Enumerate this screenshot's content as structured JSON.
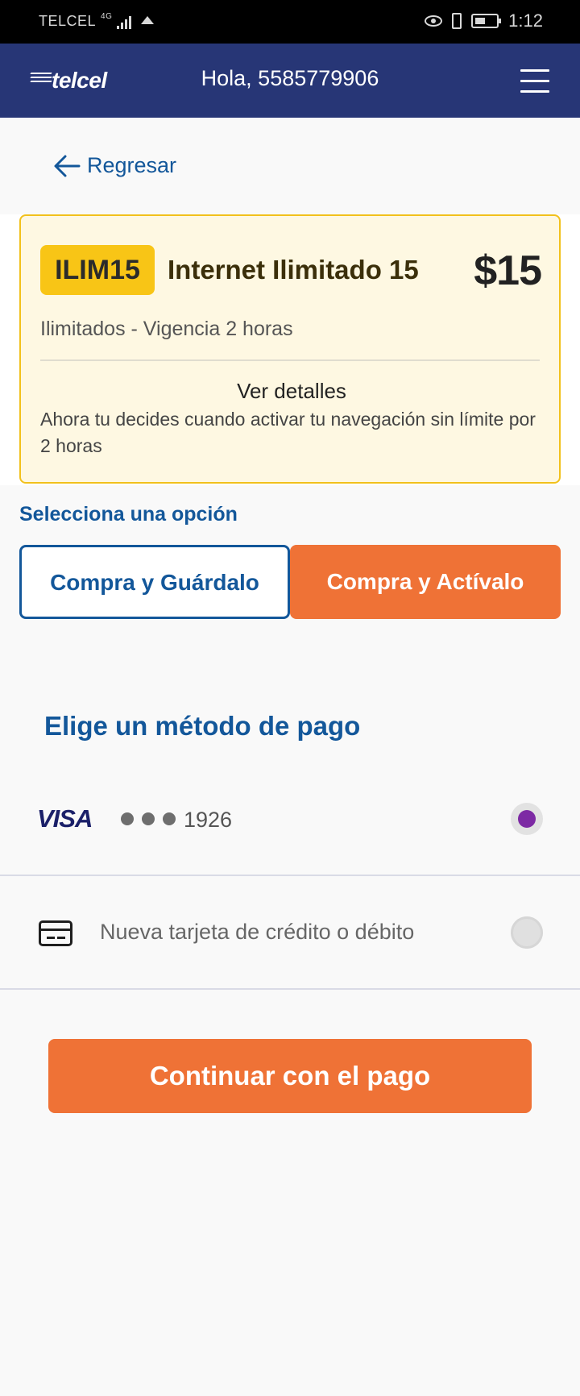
{
  "status_bar": {
    "carrier": "TELCEL",
    "network": "4G",
    "time": "1:12"
  },
  "header": {
    "logo": "telcel",
    "greeting": "Hola, 5585779906",
    "menu_icon": "hamburger-menu-icon"
  },
  "nav": {
    "back_label": "Regresar",
    "back_icon": "arrow-left-icon"
  },
  "plan": {
    "code": "ILIM15",
    "name": "Internet Ilimitado 15",
    "price": "$15",
    "subtitle": "Ilimitados - Vigencia 2 horas",
    "details_title": "Ver detalles",
    "details_text": "Ahora tu decides cuando activar tu navegación sin límite por 2 horas"
  },
  "options": {
    "label": "Selecciona una opción",
    "save_label": "Compra y Guárdalo",
    "activate_label": "Compra y Actívalo"
  },
  "payment": {
    "title": "Elige un método de pago",
    "saved_card": {
      "brand": "VISA",
      "last4": "1926",
      "selected": true
    },
    "new_card": {
      "label": "Nueva tarjeta de crédito o débito",
      "icon": "credit-card-icon",
      "selected": false
    }
  },
  "continue_label": "Continuar con el pago",
  "colors": {
    "header_bg": "#273676",
    "accent_orange": "#ef7236",
    "primary_blue": "#13579a",
    "badge_yellow": "#f8c516",
    "radio_selected": "#7d2aa4"
  }
}
